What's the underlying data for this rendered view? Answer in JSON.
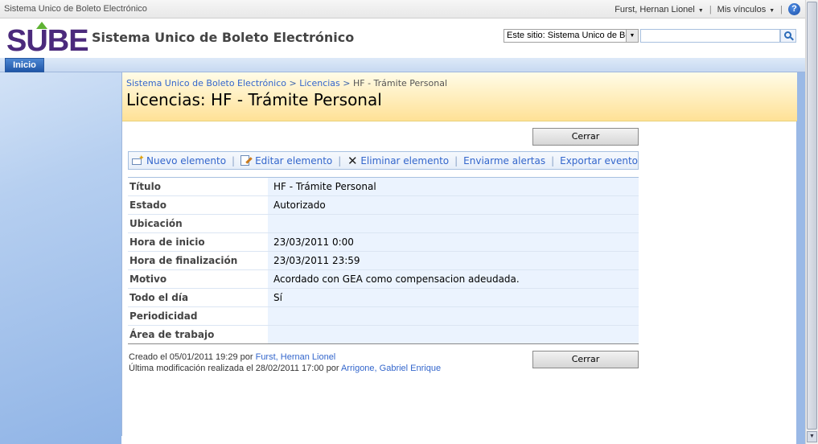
{
  "topbar": {
    "site_name": "Sistema Unico de Boleto Electrónico",
    "user_name": "Furst, Hernan Lionel",
    "my_links": "Mis vínculos",
    "help": "?"
  },
  "header": {
    "logo_text": "SUBE",
    "site_title": "Sistema Unico de Boleto Electrónico",
    "search_scope": "Este sitio: Sistema Unico de Bo",
    "search_value": ""
  },
  "topnav": {
    "tabs": [
      {
        "label": "Inicio"
      }
    ]
  },
  "page": {
    "breadcrumb": {
      "site": "Sistema Unico de Boleto Electrónico",
      "separator": " > ",
      "list": "Licencias",
      "current": "HF - Trámite Personal"
    },
    "title": "Licencias: HF - Trámite Personal",
    "close_label": "Cerrar",
    "toolbar": {
      "new_item": "Nuevo elemento",
      "edit_item": "Editar elemento",
      "delete_item": "Eliminar elemento",
      "alert_me": "Enviarme alertas",
      "export_event": "Exportar evento"
    },
    "fields": [
      {
        "label": "Título",
        "value": "HF - Trámite Personal"
      },
      {
        "label": "Estado",
        "value": "Autorizado"
      },
      {
        "label": "Ubicación",
        "value": ""
      },
      {
        "label": "Hora de inicio",
        "value": "23/03/2011 0:00"
      },
      {
        "label": "Hora de finalización",
        "value": "23/03/2011 23:59"
      },
      {
        "label": "Motivo",
        "value": "Acordado con GEA como compensacion adeudada."
      },
      {
        "label": "Todo el día",
        "value": "Sí"
      },
      {
        "label": "Periodicidad",
        "value": ""
      },
      {
        "label": "Área de trabajo",
        "value": ""
      }
    ],
    "created": {
      "text": "Creado el 05/01/2011 19:29  por ",
      "by": "Furst, Hernan Lionel"
    },
    "modified": {
      "text": "Última modificación realizada el 28/02/2011 17:00  por ",
      "by": "Arrigone, Gabriel Enrique"
    }
  }
}
